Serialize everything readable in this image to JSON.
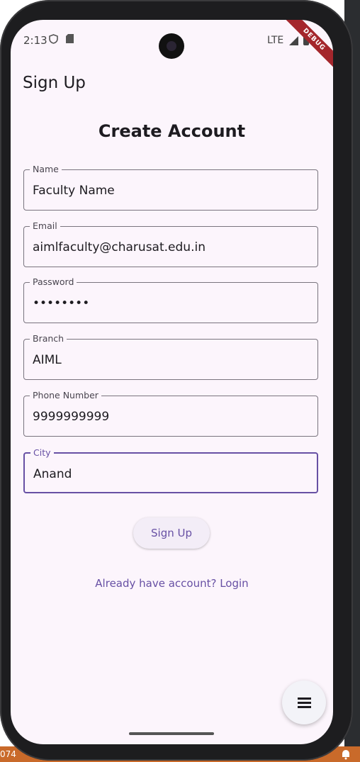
{
  "status_bar": {
    "time": "2:13",
    "network": "LTE",
    "debug_label": "DEBUG"
  },
  "app_bar": {
    "title": "Sign Up"
  },
  "form": {
    "heading": "Create Account",
    "fields": [
      {
        "label": "Name",
        "value": "Faculty Name"
      },
      {
        "label": "Email",
        "value": "aimlfaculty@charusat.edu.in"
      },
      {
        "label": "Password",
        "value": "••••••••"
      },
      {
        "label": "Branch",
        "value": "AIML"
      },
      {
        "label": "Phone Number",
        "value": "9999999999"
      },
      {
        "label": "City",
        "value": "Anand"
      }
    ],
    "submit_label": "Sign Up",
    "login_link": "Already have account? Login"
  },
  "host": {
    "left_text": "074"
  },
  "icons": {
    "fab": "menu-icon",
    "status": [
      "shield-icon",
      "sd-card-icon",
      "signal-icon",
      "battery-icon"
    ]
  },
  "colors": {
    "primary": "#6750a4",
    "background": "#fcf5fc",
    "debug": "#a4262c"
  }
}
